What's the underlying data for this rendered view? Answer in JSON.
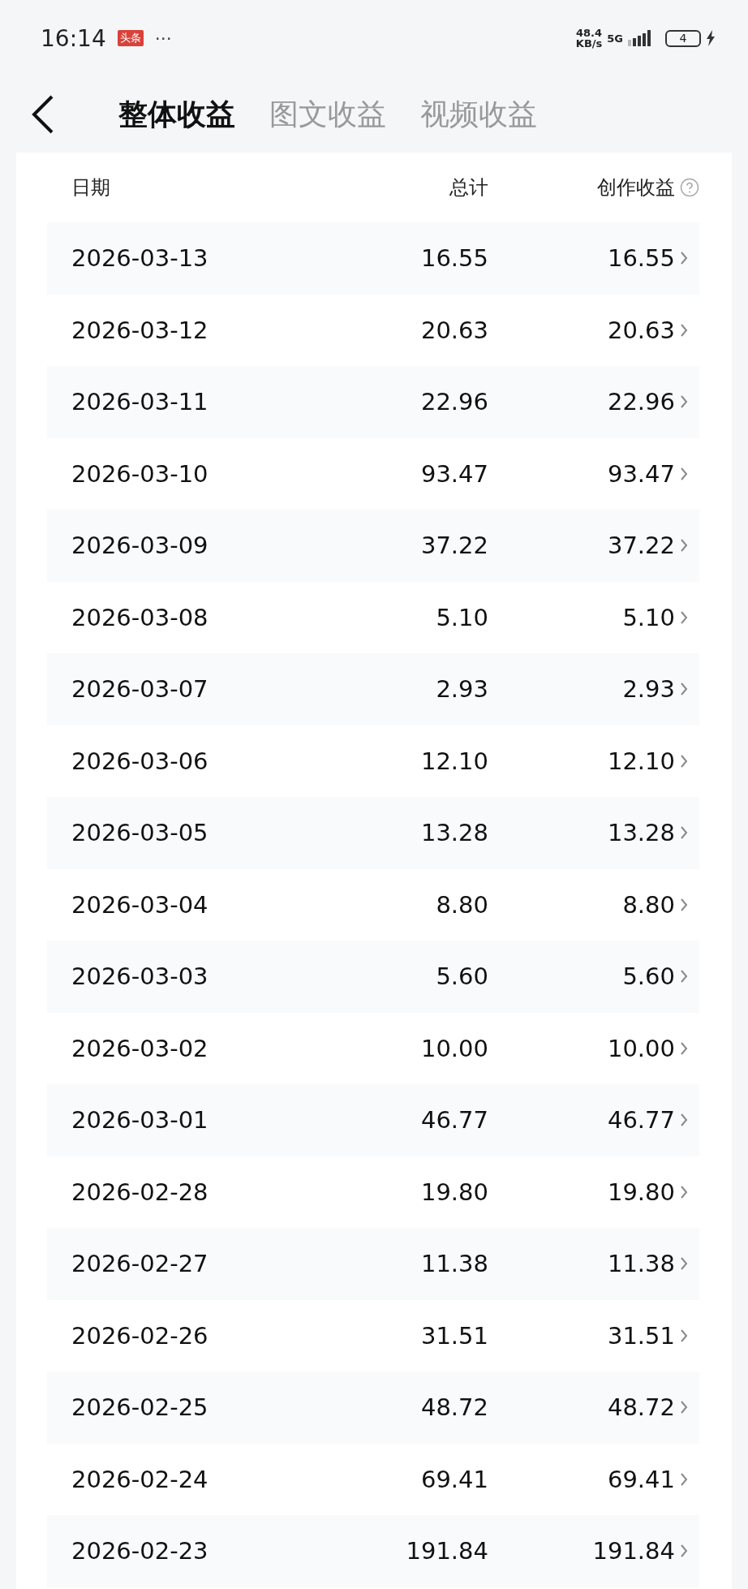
{
  "status_bar": {
    "time": "16:14",
    "app_badge": "头条",
    "more": "···",
    "speed": "48.4",
    "speed_unit": "KB/s",
    "network": "5G",
    "battery": "4",
    "charging": true
  },
  "tabs": [
    {
      "label": "整体收益",
      "selected": true
    },
    {
      "label": "图文收益",
      "selected": false
    },
    {
      "label": "视频收益",
      "selected": false
    }
  ],
  "table": {
    "columns": [
      "日期",
      "总计",
      "创作收益"
    ],
    "rows": [
      {
        "date": "2026-03-13",
        "total": "16.55",
        "creation": "16.55"
      },
      {
        "date": "2026-03-12",
        "total": "20.63",
        "creation": "20.63"
      },
      {
        "date": "2026-03-11",
        "total": "22.96",
        "creation": "22.96"
      },
      {
        "date": "2026-03-10",
        "total": "93.47",
        "creation": "93.47"
      },
      {
        "date": "2026-03-09",
        "total": "37.22",
        "creation": "37.22"
      },
      {
        "date": "2026-03-08",
        "total": "5.10",
        "creation": "5.10"
      },
      {
        "date": "2026-03-07",
        "total": "2.93",
        "creation": "2.93"
      },
      {
        "date": "2026-03-06",
        "total": "12.10",
        "creation": "12.10"
      },
      {
        "date": "2026-03-05",
        "total": "13.28",
        "creation": "13.28"
      },
      {
        "date": "2026-03-04",
        "total": "8.80",
        "creation": "8.80"
      },
      {
        "date": "2026-03-03",
        "total": "5.60",
        "creation": "5.60"
      },
      {
        "date": "2026-03-02",
        "total": "10.00",
        "creation": "10.00"
      },
      {
        "date": "2026-03-01",
        "total": "46.77",
        "creation": "46.77"
      },
      {
        "date": "2026-02-28",
        "total": "19.80",
        "creation": "19.80"
      },
      {
        "date": "2026-02-27",
        "total": "11.38",
        "creation": "11.38"
      },
      {
        "date": "2026-02-26",
        "total": "31.51",
        "creation": "31.51"
      },
      {
        "date": "2026-02-25",
        "total": "48.72",
        "creation": "48.72"
      },
      {
        "date": "2026-02-24",
        "total": "69.41",
        "creation": "69.41"
      },
      {
        "date": "2026-02-23",
        "total": "191.84",
        "creation": "191.84"
      }
    ]
  }
}
